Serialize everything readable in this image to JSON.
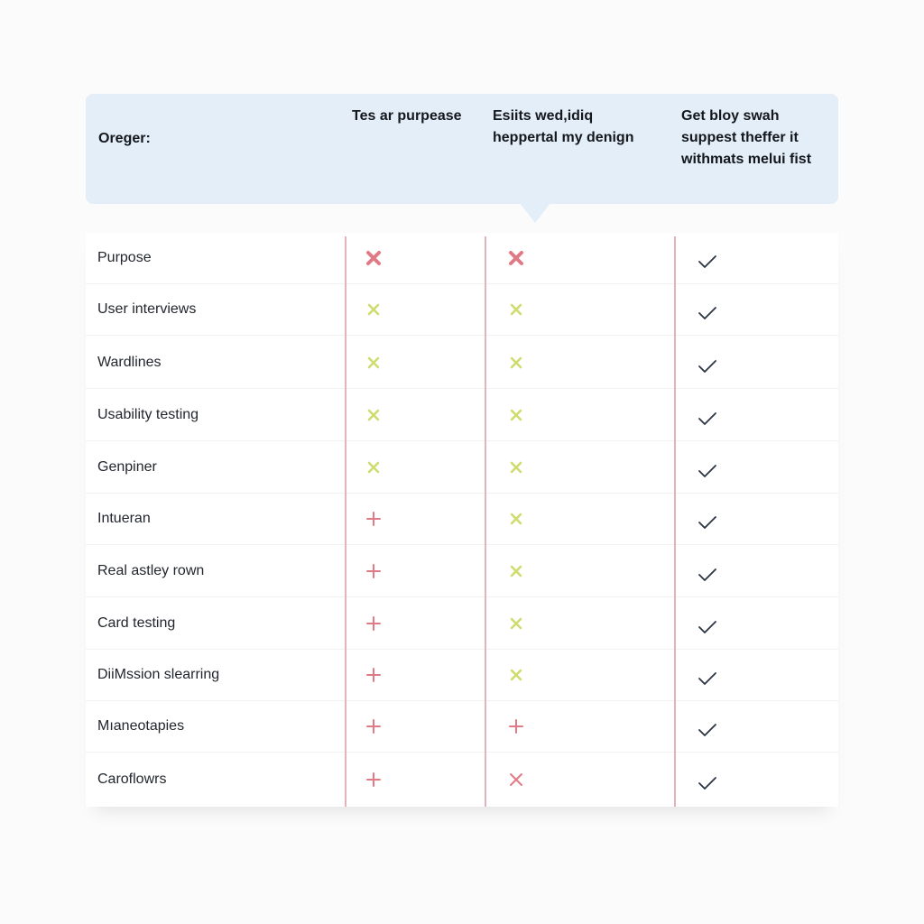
{
  "colors": {
    "header_bg": "#e3eef8",
    "divider": "#e4b3b9",
    "red": "#e07a86",
    "lime": "#cfdc6e",
    "check": "#2b3442"
  },
  "header": {
    "columns": [
      "Oreger:",
      "Tes ar purpease",
      "Esiits wed,idiq heppertal my denign",
      "Get bloy swah suppest theffer it withmats melui fist"
    ]
  },
  "rows": [
    {
      "label": "Purpose",
      "cells": [
        "x-bold-red",
        "x-bold-red",
        "check"
      ]
    },
    {
      "label": "User interviews",
      "cells": [
        "x-lime",
        "x-lime",
        "check"
      ]
    },
    {
      "label": "Wardlines",
      "cells": [
        "x-lime",
        "x-lime",
        "check"
      ]
    },
    {
      "label": "Usability testing",
      "cells": [
        "x-lime",
        "x-lime",
        "check"
      ]
    },
    {
      "label": "Genpiner",
      "cells": [
        "x-lime",
        "x-lime",
        "check"
      ]
    },
    {
      "label": "Intueran",
      "cells": [
        "plus-red",
        "x-lime",
        "check"
      ]
    },
    {
      "label": "Real astley rown",
      "cells": [
        "plus-red",
        "x-lime",
        "check"
      ]
    },
    {
      "label": "Card testing",
      "cells": [
        "plus-red",
        "x-lime",
        "check"
      ]
    },
    {
      "label": "DiiMssion slearring",
      "cells": [
        "plus-red",
        "x-lime",
        "check"
      ]
    },
    {
      "label": "Mıaneotapies",
      "cells": [
        "plus-red",
        "plus-red",
        "check"
      ]
    },
    {
      "label": "Caroflowrs",
      "cells": [
        "plus-red",
        "x-thin-red",
        "check"
      ]
    }
  ]
}
